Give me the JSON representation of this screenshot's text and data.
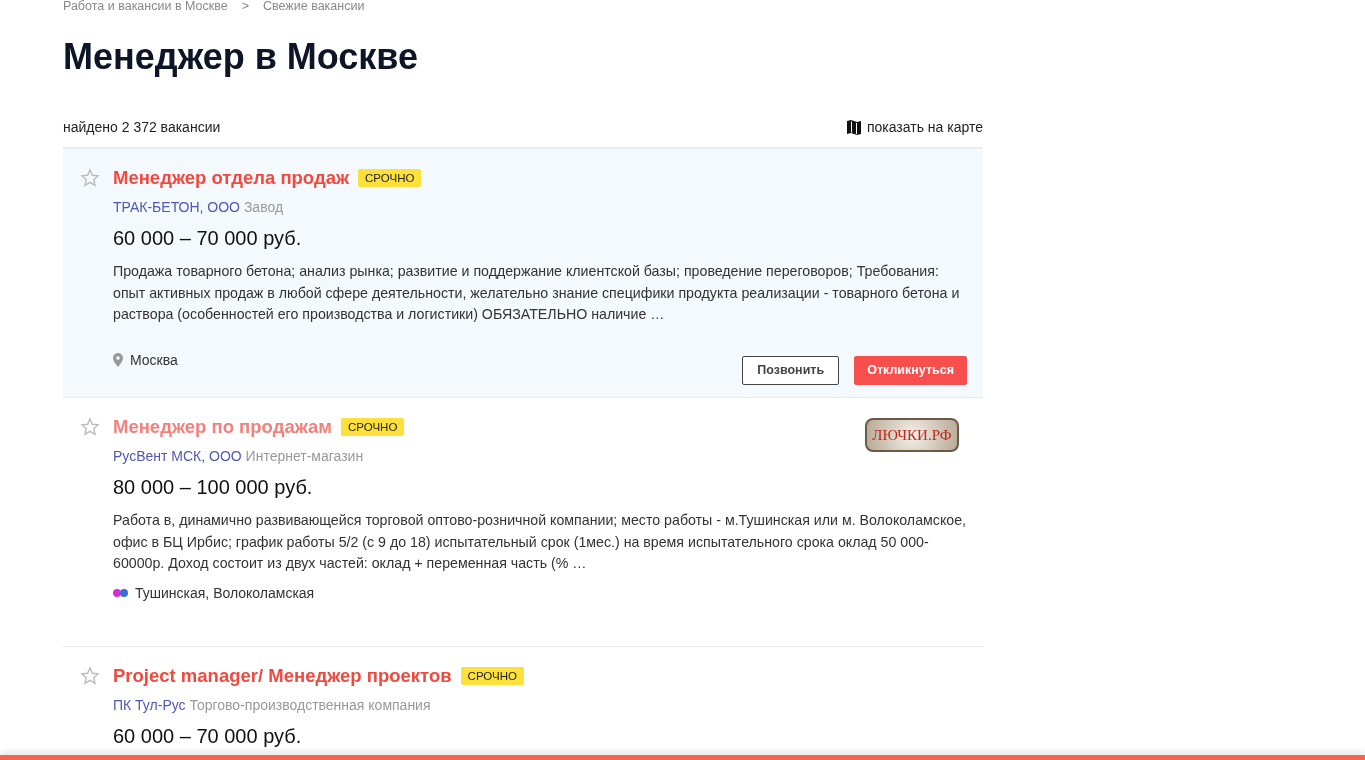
{
  "breadcrumbs": [
    {
      "label": "Работа и вакансии в Москве"
    },
    {
      "label": "Свежие вакансии"
    }
  ],
  "breadcrumb_separator": ">",
  "title": "Менеджер в Москве",
  "found": "найдено 2 372 вакансии",
  "map_link": "показать на карте",
  "vacancies": [
    {
      "title": "Менеджер отдела продаж",
      "visited": false,
      "highlighted": true,
      "favorite": false,
      "badge": "СРОЧНО",
      "company": "ТРАК-БЕТОН, ООО",
      "company_type": "Завод",
      "salary": "60 000 – 70 000 руб.",
      "description": "Продажа товарного бетона; анализ рынка; развитие и поддержание клиентской базы; проведение переговоров; Требования: опыт активных продаж в любой сфере деятельности, желательно знание специфики продукта реализации - товарного бетона и раствора (особенностей его производства и логистики) ОБЯЗАТЕЛЬНО наличие …",
      "location": {
        "kind": "city",
        "text": "Москва"
      },
      "buttons": [
        {
          "label": "Позвонить",
          "kind": "outline"
        },
        {
          "label": "Откликнуться",
          "kind": "primary"
        }
      ]
    },
    {
      "title": "Менеджер по продажам",
      "visited": true,
      "highlighted": false,
      "favorite": false,
      "badge": "СРОЧНО",
      "company": "РусВент МСК, ООО",
      "company_type": "Интернет-магазин",
      "logo_text": "ЛЮЧКИ.РФ",
      "salary": "80 000 – 100 000 руб.",
      "description": "Работа в, динамично развивающейся торговой оптово-розничной компании; место работы - м.Тушинская или м. Волоколамское, офис в БЦ Ирбис; график работы 5/2 (с 9 до 18) испытательный срок (1мес.) на время испытательного срока оклад 50 000-60000р. Доход состоит из двух частей: оклад + переменная часть (% …",
      "location": {
        "kind": "metro",
        "text": "Тушинская, Волоколамская",
        "lines": [
          {
            "color": "#d42cdb"
          },
          {
            "color": "#3a6bd6"
          }
        ]
      }
    },
    {
      "title": "Project manager/ Менеджер проектов",
      "visited": false,
      "highlighted": false,
      "favorite": false,
      "badge": "СРОЧНО",
      "company": "ПК Тул-Рус",
      "company_type": "Торгово-производственная компания",
      "salary": "60 000 – 70 000 руб."
    }
  ]
}
